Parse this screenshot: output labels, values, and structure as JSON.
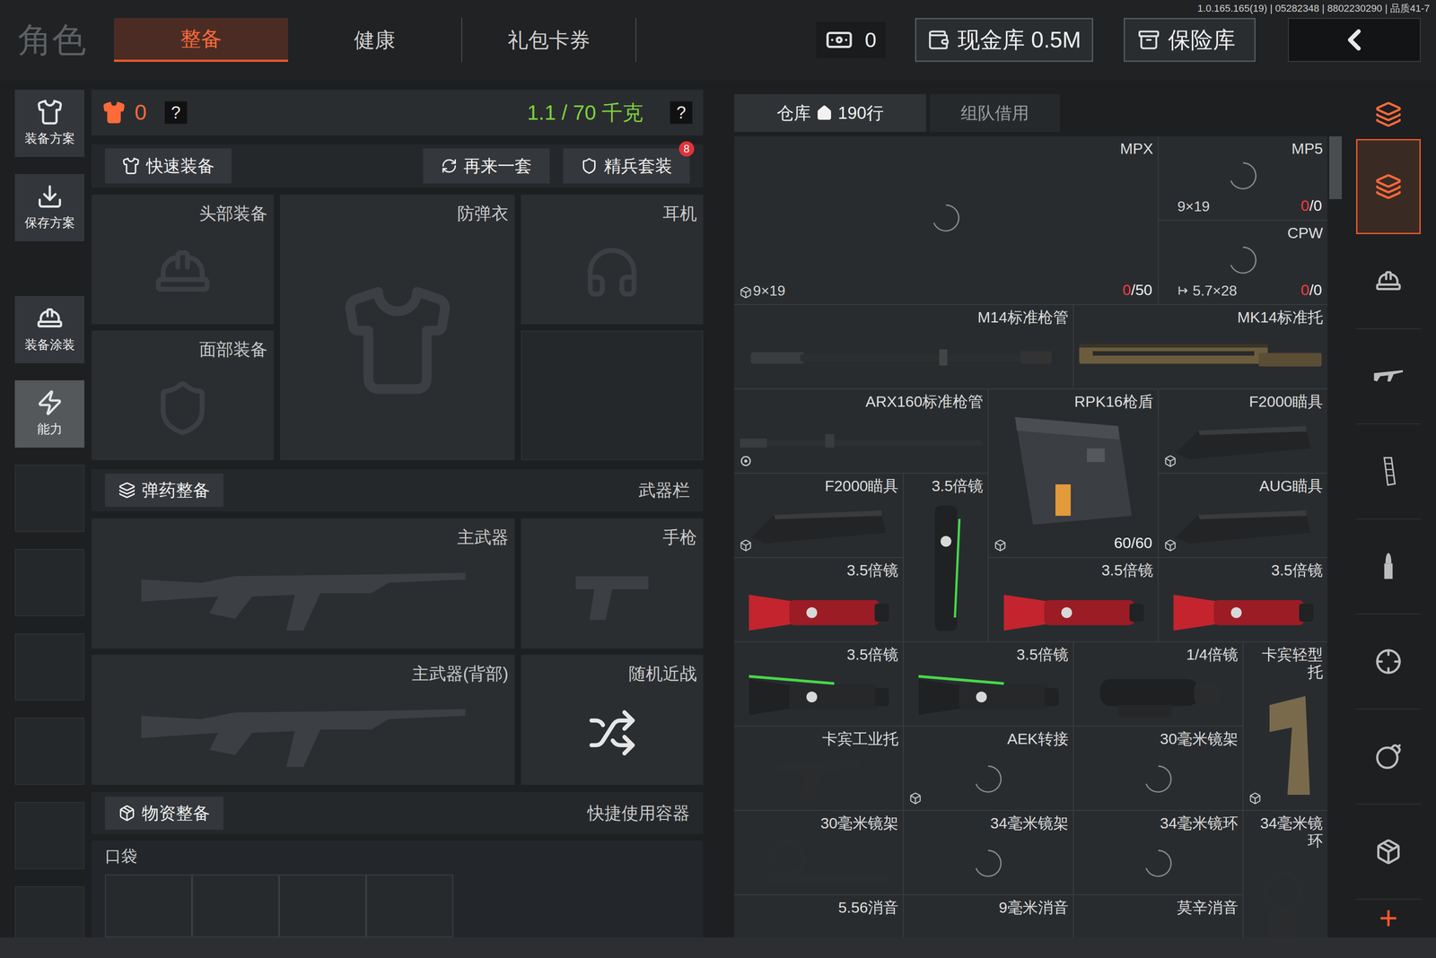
{
  "version": "1.0.165.165(19) | 05282348 | 8802230290 | 品质41-7",
  "top_bar": {
    "title": "角色",
    "tabs": [
      {
        "label": "整备",
        "selected": true
      },
      {
        "label": "健康",
        "selected": false
      },
      {
        "label": "礼包卡券",
        "selected": false
      }
    ],
    "cash": "0",
    "cash_vault": "现金库 0.5M",
    "safe_vault": "保险库"
  },
  "sidebar": [
    {
      "label": "装备方案",
      "selected": false
    },
    {
      "label": "保存方案",
      "selected": false
    },
    {
      "label": "装备涂装",
      "selected": false
    },
    {
      "label": "能力",
      "selected": true
    }
  ],
  "loadout": {
    "armor_class": "0",
    "help": "?",
    "weight": "1.1 / 70 千克",
    "actions": [
      {
        "label": "快速装备",
        "badge": ""
      },
      {
        "label": "再来一套",
        "badge": ""
      },
      {
        "label": "精兵套装",
        "badge": "8"
      }
    ],
    "gear_slots": [
      "头部装备",
      "防弹衣",
      "耳机",
      "面部装备"
    ],
    "ammo_button": "弹药整备",
    "weapon_header": "武器栏",
    "weapon_slots": [
      "主武器",
      "手枪",
      "主武器(背部)",
      "随机近战"
    ],
    "supply_button": "物资整备",
    "quick_container": "快捷使用容器",
    "pocket": "口袋"
  },
  "stash": {
    "tabs": [
      {
        "label": "仓库",
        "count": "190行",
        "selected": true
      },
      {
        "label": "组队借用",
        "count": "",
        "selected": false
      }
    ],
    "items": [
      {
        "label": "MPX",
        "kind": "loading",
        "caliber": "9×19",
        "caliber_icon": false,
        "count_current": "0",
        "count_max": "/50",
        "count_empty": true,
        "tag": "box"
      },
      {
        "label": "MP5",
        "kind": "loading",
        "caliber": "9×19",
        "caliber_icon": false,
        "count_current": "0",
        "count_max": "/0",
        "count_empty": true,
        "tag": "none"
      },
      {
        "label": "CPW",
        "kind": "loading",
        "caliber": "5.7×28",
        "caliber_icon": true,
        "count_current": "0",
        "count_max": "/0",
        "count_empty": true,
        "tag": "none"
      },
      {
        "label": "M14标准枪管",
        "kind": "barrel",
        "caliber": "",
        "caliber_icon": false,
        "count_current": "",
        "count_max": "",
        "count_empty": false,
        "tag": "none"
      },
      {
        "label": "MK14标准托",
        "kind": "handguard",
        "caliber": "",
        "caliber_icon": false,
        "count_current": "",
        "count_max": "",
        "count_empty": false,
        "tag": "none"
      },
      {
        "label": "ARX160标准枪管",
        "kind": "barrel-thin",
        "caliber": "",
        "caliber_icon": false,
        "count_current": "",
        "count_max": "",
        "count_empty": false,
        "tag": "ring"
      },
      {
        "label": "RPK16枪盾",
        "kind": "shield",
        "caliber": "",
        "caliber_icon": false,
        "count_current": "60",
        "count_max": "/60",
        "count_empty": false,
        "tag": "box"
      },
      {
        "label": "F2000瞄具",
        "kind": "sight",
        "caliber": "",
        "caliber_icon": false,
        "count_current": "",
        "count_max": "",
        "count_empty": false,
        "tag": "box"
      },
      {
        "label": "F2000瞄具",
        "kind": "sight",
        "caliber": "",
        "caliber_icon": false,
        "count_current": "",
        "count_max": "",
        "count_empty": false,
        "tag": "box"
      },
      {
        "label": "3.5倍镜",
        "kind": "scope-vertical",
        "caliber": "",
        "caliber_icon": false,
        "count_current": "",
        "count_max": "",
        "count_empty": false,
        "tag": "none"
      },
      {
        "label": "AUG瞄具",
        "kind": "sight",
        "caliber": "",
        "caliber_icon": false,
        "count_current": "",
        "count_max": "",
        "count_empty": false,
        "tag": "box"
      },
      {
        "label": "3.5倍镜",
        "kind": "scope-red",
        "caliber": "",
        "caliber_icon": false,
        "count_current": "",
        "count_max": "",
        "count_empty": false,
        "tag": "none"
      },
      {
        "label": "3.5倍镜",
        "kind": "scope-red",
        "caliber": "",
        "caliber_icon": false,
        "count_current": "",
        "count_max": "",
        "count_empty": false,
        "tag": "none"
      },
      {
        "label": "3.5倍镜",
        "kind": "scope-red",
        "caliber": "",
        "caliber_icon": false,
        "count_current": "",
        "count_max": "",
        "count_empty": false,
        "tag": "none"
      },
      {
        "label": "3.5倍镜",
        "kind": "scope-green",
        "caliber": "",
        "caliber_icon": false,
        "count_current": "",
        "count_max": "",
        "count_empty": false,
        "tag": "none"
      },
      {
        "label": "3.5倍镜",
        "kind": "scope-green",
        "caliber": "",
        "caliber_icon": false,
        "count_current": "",
        "count_max": "",
        "count_empty": false,
        "tag": "none"
      },
      {
        "label": "1/4倍镜",
        "kind": "scope-short",
        "caliber": "",
        "caliber_icon": false,
        "count_current": "",
        "count_max": "",
        "count_empty": false,
        "tag": "none"
      },
      {
        "label": "卡宾轻型托",
        "kind": "stock-tan",
        "caliber": "",
        "caliber_icon": false,
        "count_current": "",
        "count_max": "",
        "count_empty": false,
        "tag": "box"
      },
      {
        "label": "卡宾工业托",
        "kind": "stock",
        "caliber": "",
        "caliber_icon": false,
        "count_current": "",
        "count_max": "",
        "count_empty": false,
        "tag": "none"
      },
      {
        "label": "AEK转接",
        "kind": "loading",
        "caliber": "",
        "caliber_icon": false,
        "count_current": "",
        "count_max": "",
        "count_empty": false,
        "tag": "box"
      },
      {
        "label": "30毫米镜架",
        "kind": "loading",
        "caliber": "",
        "caliber_icon": false,
        "count_current": "",
        "count_max": "",
        "count_empty": false,
        "tag": "none"
      },
      {
        "label": "30毫米镜架",
        "kind": "mount",
        "caliber": "",
        "caliber_icon": false,
        "count_current": "",
        "count_max": "",
        "count_empty": false,
        "tag": "none"
      },
      {
        "label": "34毫米镜架",
        "kind": "loading",
        "caliber": "",
        "caliber_icon": false,
        "count_current": "",
        "count_max": "",
        "count_empty": false,
        "tag": "none"
      },
      {
        "label": "34毫米镜环",
        "kind": "loading",
        "caliber": "",
        "caliber_icon": false,
        "count_current": "",
        "count_max": "",
        "count_empty": false,
        "tag": "none"
      },
      {
        "label": "34毫米镜环",
        "kind": "ring",
        "caliber": "",
        "caliber_icon": false,
        "count_current": "",
        "count_max": "",
        "count_empty": false,
        "tag": "none"
      },
      {
        "label": "5.56消音",
        "kind": "suppressor",
        "caliber": "",
        "caliber_icon": false,
        "count_current": "",
        "count_max": "",
        "count_empty": false,
        "tag": "none"
      },
      {
        "label": "9毫米消音",
        "kind": "suppressor",
        "caliber": "",
        "caliber_icon": false,
        "count_current": "",
        "count_max": "",
        "count_empty": false,
        "tag": "none"
      },
      {
        "label": "莫辛消音",
        "kind": "suppressor",
        "caliber": "",
        "caliber_icon": false,
        "count_current": "",
        "count_max": "",
        "count_empty": false,
        "tag": "none"
      }
    ]
  },
  "filters": [
    {
      "kind": "all",
      "selected": true
    },
    {
      "kind": "gear",
      "selected": false
    },
    {
      "kind": "weapon",
      "selected": false
    },
    {
      "kind": "magazine",
      "selected": false
    },
    {
      "kind": "ammo",
      "selected": false
    },
    {
      "kind": "sight",
      "selected": false
    },
    {
      "kind": "grenade",
      "selected": false
    },
    {
      "kind": "container",
      "selected": false
    }
  ],
  "add_button": "+"
}
